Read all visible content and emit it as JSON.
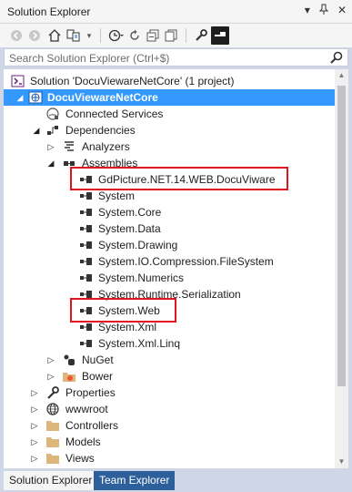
{
  "window": {
    "title": "Solution Explorer",
    "controls": [
      "▾",
      "📌",
      "✕"
    ]
  },
  "toolbar": {
    "buttons": [
      "back-icon",
      "forward-icon",
      "home-icon",
      "sync-with-active-document-icon",
      "dropdown-icon",
      "pending-changes-filter-icon",
      "refresh-icon",
      "collapse-all-icon",
      "show-all-files-icon",
      "properties-icon",
      "preview-icon"
    ]
  },
  "search": {
    "placeholder": "Search Solution Explorer (Ctrl+$)"
  },
  "tree": {
    "items": [
      {
        "label": "Solution 'DocuViewareNetCore' (1 project)",
        "icon": "solution-icon"
      },
      {
        "label": "DocuViewareNetCore",
        "icon": "web-project-icon"
      },
      {
        "label": "Connected Services",
        "icon": "connected-services-icon"
      },
      {
        "label": "Dependencies",
        "icon": "dependencies-icon"
      },
      {
        "label": "Analyzers",
        "icon": "analyzers-icon"
      },
      {
        "label": "Assemblies",
        "icon": "assemblies-icon"
      },
      {
        "label": "GdPicture.NET.14.WEB.DocuViware",
        "icon": "reference-icon"
      },
      {
        "label": "System",
        "icon": "reference-icon"
      },
      {
        "label": "System.Core",
        "icon": "reference-icon"
      },
      {
        "label": "System.Data",
        "icon": "reference-icon"
      },
      {
        "label": "System.Drawing",
        "icon": "reference-icon"
      },
      {
        "label": "System.IO.Compression.FileSystem",
        "icon": "reference-icon"
      },
      {
        "label": "System.Numerics",
        "icon": "reference-icon"
      },
      {
        "label": "System.Runtime.Serialization",
        "icon": "reference-icon"
      },
      {
        "label": "System.Web",
        "icon": "reference-icon"
      },
      {
        "label": "System.Xml",
        "icon": "reference-icon"
      },
      {
        "label": "System.Xml.Linq",
        "icon": "reference-icon"
      },
      {
        "label": "NuGet",
        "icon": "nuget-icon"
      },
      {
        "label": "Bower",
        "icon": "bower-icon"
      },
      {
        "label": "Properties",
        "icon": "wrench-icon"
      },
      {
        "label": "wwwroot",
        "icon": "globe-icon"
      },
      {
        "label": "Controllers",
        "icon": "folder-icon"
      },
      {
        "label": "Models",
        "icon": "folder-icon"
      },
      {
        "label": "Views",
        "icon": "folder-icon"
      }
    ]
  },
  "tabs": {
    "solution_explorer": "Solution Explorer",
    "team_explorer": "Team Explorer"
  },
  "colors": {
    "selection": "#3399ff",
    "highlight_box": "#e0141e",
    "inactive_tab": "#2d5f9a",
    "chrome": "#cfd6e5"
  }
}
